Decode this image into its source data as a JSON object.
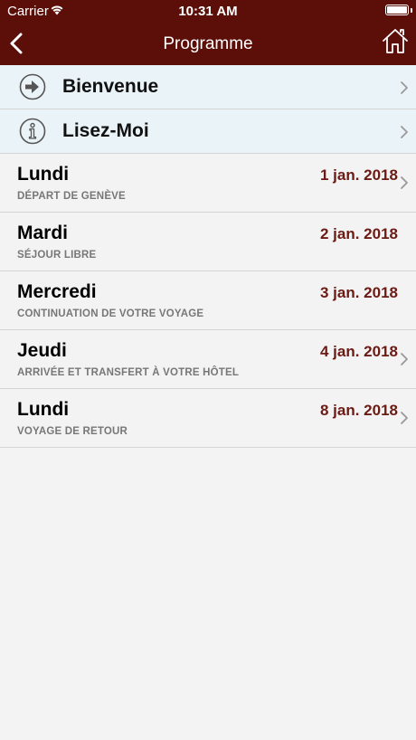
{
  "status_bar": {
    "carrier": "Carrier",
    "time": "10:31 AM"
  },
  "nav": {
    "title": "Programme"
  },
  "special_items": [
    {
      "label": "Bienvenue",
      "icon": "arrow-right-circle-icon"
    },
    {
      "label": "Lisez-Moi",
      "icon": "info-circle-icon"
    }
  ],
  "days": [
    {
      "title": "Lundi",
      "subtitle": "DÉPART DE GENÈVE",
      "date": "1 jan. 2018",
      "has_chevron": true
    },
    {
      "title": "Mardi",
      "subtitle": "SÉJOUR LIBRE",
      "date": "2 jan. 2018",
      "has_chevron": false
    },
    {
      "title": "Mercredi",
      "subtitle": "CONTINUATION DE VOTRE VOYAGE",
      "date": "3 jan. 2018",
      "has_chevron": false
    },
    {
      "title": "Jeudi",
      "subtitle": "ARRIVÉE ET TRANSFERT À VOTRE HÔTEL",
      "date": "4 jan. 2018",
      "has_chevron": true
    },
    {
      "title": "Lundi",
      "subtitle": "VOYAGE DE RETOUR",
      "date": "8 jan. 2018",
      "has_chevron": true
    }
  ],
  "colors": {
    "nav_background": "#5b0f08",
    "date_text": "#6b1a14",
    "special_row_background": "#eaf3f8",
    "page_background": "#f3f3f3"
  }
}
